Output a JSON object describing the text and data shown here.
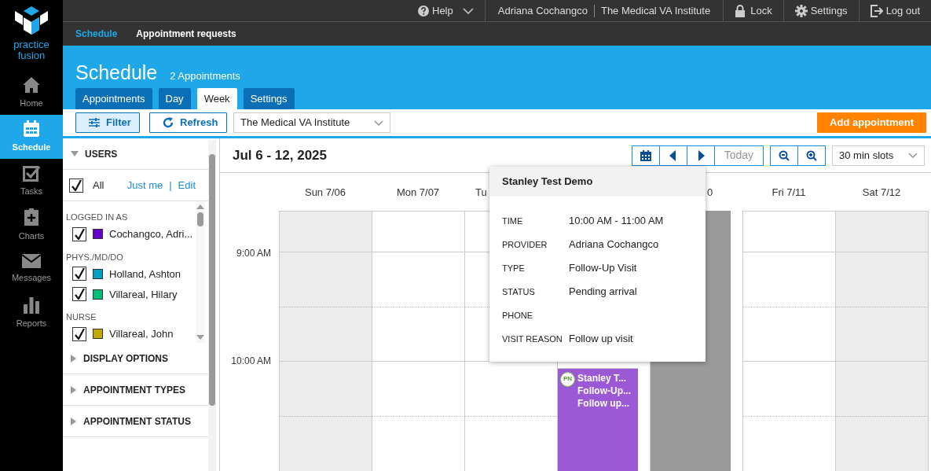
{
  "brand": {
    "name": "practice fusion"
  },
  "nav": [
    {
      "label": "Home",
      "selected": false
    },
    {
      "label": "Schedule",
      "selected": true
    },
    {
      "label": "Tasks",
      "selected": false
    },
    {
      "label": "Charts",
      "selected": false
    },
    {
      "label": "Messages",
      "selected": false
    },
    {
      "label": "Reports",
      "selected": false
    }
  ],
  "topbar": {
    "help": "Help",
    "user": "Adriana Cochangco",
    "practice": "The Medical VA Institute",
    "lock": "Lock",
    "settings": "Settings",
    "logout": "Log out"
  },
  "subnav": [
    {
      "label": "Schedule",
      "selected": true
    },
    {
      "label": "Appointment requests",
      "selected": false
    }
  ],
  "header": {
    "title": "Schedule",
    "count": "2 Appointments"
  },
  "tabs": [
    {
      "label": "Appointments",
      "selected": false
    },
    {
      "label": "Day",
      "selected": false
    },
    {
      "label": "Week",
      "selected": true
    },
    {
      "label": "Settings",
      "selected": false
    }
  ],
  "toolbar": {
    "filter": "Filter",
    "filter_active": true,
    "refresh": "Refresh",
    "facility": "The Medical VA Institute",
    "add": "Add appointment"
  },
  "filters": {
    "users": {
      "title": "USERS",
      "expanded": true,
      "all": {
        "label": "All",
        "checked": true
      },
      "just_me": "Just me",
      "separator": "|",
      "edit": "Edit",
      "groups": [
        {
          "label": "LOGGED IN AS",
          "users": [
            {
              "name": "Cochangco, Adri...",
              "checked": true,
              "color": "#6400c8"
            }
          ]
        },
        {
          "label": "PHYS./MD/DO",
          "users": [
            {
              "name": "Holland, Ashton",
              "checked": true,
              "color": "#00a0c0"
            },
            {
              "name": "Villareal, Hilary",
              "checked": true,
              "color": "#00c078"
            }
          ]
        },
        {
          "label": "NURSE",
          "users": [
            {
              "name": "Villareal, John",
              "checked": true,
              "color": "#c0a800"
            }
          ]
        }
      ]
    },
    "sections": [
      {
        "title": "DISPLAY OPTIONS",
        "expanded": false
      },
      {
        "title": "APPOINTMENT TYPES",
        "expanded": false
      },
      {
        "title": "APPOINTMENT STATUS",
        "expanded": false
      }
    ]
  },
  "calendar": {
    "range": "Jul 6 - 12, 2025",
    "today": "Today",
    "slots": "30 min slots",
    "days": [
      {
        "label": "Sun 7/06",
        "kind": "weekend"
      },
      {
        "label": "Mon 7/07",
        "kind": "weekday"
      },
      {
        "label": "Tu",
        "kind": "weekday"
      },
      {
        "kind": "weekday",
        "appointment": {
          "title": "Stanley T...",
          "type": "Follow-Up...",
          "reason": "Follow up...",
          "badge": "PN",
          "color": "#9b59d6"
        }
      },
      {
        "label": "0",
        "kind": "blocked"
      },
      {
        "label": "Fri 7/11",
        "kind": "weekday"
      },
      {
        "label": "Sat 7/12",
        "kind": "weekend"
      }
    ],
    "hours": [
      "9:00 AM",
      "10:00 AM"
    ],
    "popover": {
      "title": "Stanley Test Demo",
      "fields": [
        {
          "label": "TIME",
          "value": "10:00 AM - 11:00 AM"
        },
        {
          "label": "PROVIDER",
          "value": "Adriana Cochangco"
        },
        {
          "label": "TYPE",
          "value": "Follow-Up Visit"
        },
        {
          "label": "STATUS",
          "value": "Pending arrival"
        },
        {
          "label": "PHONE"
        },
        {
          "label": "VISIT REASON",
          "value": "Follow up visit"
        }
      ]
    }
  }
}
